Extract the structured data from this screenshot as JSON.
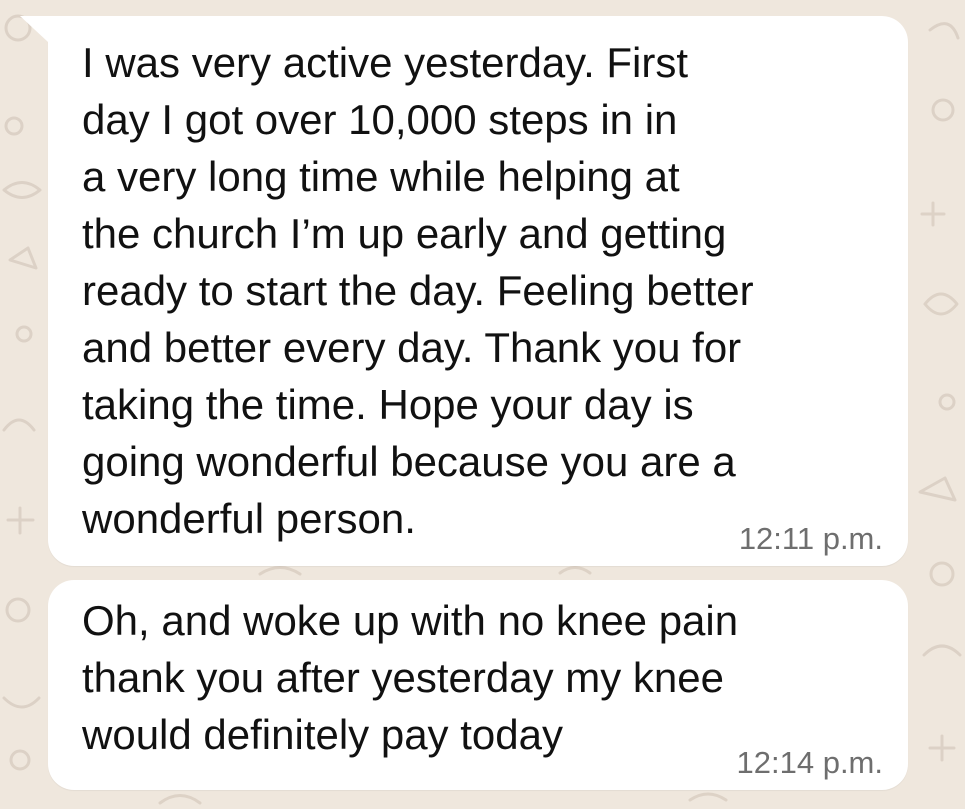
{
  "messages": [
    {
      "text": "I was very active yesterday. First\nday I got over 10,000 steps in in\na very long time while helping at\nthe church I’m up early and getting\nready to start the day. Feeling better\nand better every day. Thank you for\ntaking the time. Hope your day is\ngoing wonderful because you are a\nwonderful person.",
      "time": "12:11 p.m."
    },
    {
      "text": "Oh, and woke up with no knee pain\nthank you after yesterday my knee\nwould definitely pay today",
      "time": "12:14 p.m."
    }
  ],
  "colors": {
    "background": "#efe7dd",
    "bubble": "#ffffff",
    "text": "#111111",
    "timestamp": "#6e6e6e"
  }
}
